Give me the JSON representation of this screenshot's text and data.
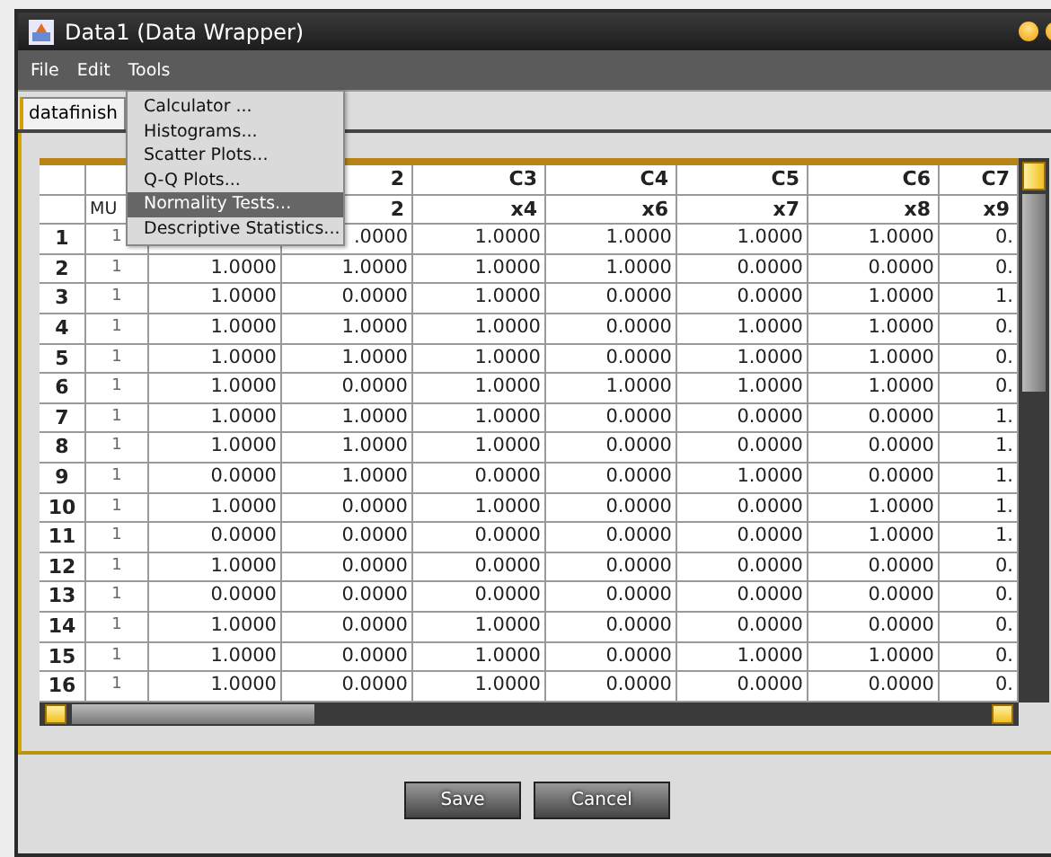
{
  "window": {
    "title": "Data1 (Data Wrapper)"
  },
  "menu_bar": [
    "File",
    "Edit",
    "Tools"
  ],
  "tools_menu": [
    {
      "label": "Calculator ...",
      "selected": false
    },
    {
      "label": "Histograms...",
      "selected": false
    },
    {
      "label": "Scatter Plots...",
      "selected": false
    },
    {
      "label": "Q-Q Plots...",
      "selected": false
    },
    {
      "label": "Normality Tests...",
      "selected": true
    },
    {
      "label": "Descriptive Statistics...",
      "selected": false
    }
  ],
  "tabs": [
    {
      "label": "datafinish",
      "selected": true
    }
  ],
  "table": {
    "columns": [
      {
        "name": "MU"
      },
      {},
      {
        "id": "2",
        "name": "2"
      },
      {
        "id": "C3",
        "name": "x4"
      },
      {
        "id": "C4",
        "name": "x6"
      },
      {
        "id": "C5",
        "name": "x7"
      },
      {
        "id": "C6",
        "name": "x8"
      },
      {
        "id": "C7",
        "name": "x9"
      }
    ],
    "rows": [
      {
        "number": "1",
        "cells": [
          "1",
          {
            "covered": true
          },
          ".0000",
          "1.0000",
          "1.0000",
          "1.0000",
          "1.0000",
          "0."
        ]
      },
      {
        "number": "2",
        "cells": [
          "1",
          "1.0000",
          "1.0000",
          "1.0000",
          "1.0000",
          "0.0000",
          "0.0000",
          "0."
        ]
      },
      {
        "number": "3",
        "cells": [
          "1",
          "1.0000",
          "0.0000",
          "1.0000",
          "0.0000",
          "0.0000",
          "1.0000",
          "1."
        ]
      },
      {
        "number": "4",
        "cells": [
          "1",
          "1.0000",
          "1.0000",
          "1.0000",
          "0.0000",
          "1.0000",
          "1.0000",
          "0."
        ]
      },
      {
        "number": "5",
        "cells": [
          "1",
          "1.0000",
          "1.0000",
          "1.0000",
          "0.0000",
          "1.0000",
          "1.0000",
          "0."
        ]
      },
      {
        "number": "6",
        "cells": [
          "1",
          "1.0000",
          "0.0000",
          "1.0000",
          "1.0000",
          "1.0000",
          "1.0000",
          "0."
        ]
      },
      {
        "number": "7",
        "cells": [
          "1",
          "1.0000",
          "1.0000",
          "1.0000",
          "0.0000",
          "0.0000",
          "0.0000",
          "1."
        ]
      },
      {
        "number": "8",
        "cells": [
          "1",
          "1.0000",
          "1.0000",
          "1.0000",
          "0.0000",
          "0.0000",
          "0.0000",
          "1."
        ]
      },
      {
        "number": "9",
        "cells": [
          "1",
          "0.0000",
          "1.0000",
          "0.0000",
          "0.0000",
          "1.0000",
          "0.0000",
          "1."
        ]
      },
      {
        "number": "10",
        "cells": [
          "1",
          "1.0000",
          "0.0000",
          "1.0000",
          "0.0000",
          "0.0000",
          "1.0000",
          "1."
        ]
      },
      {
        "number": "11",
        "cells": [
          "1",
          "0.0000",
          "0.0000",
          "0.0000",
          "0.0000",
          "0.0000",
          "1.0000",
          "1."
        ]
      },
      {
        "number": "12",
        "cells": [
          "1",
          "1.0000",
          "0.0000",
          "0.0000",
          "0.0000",
          "0.0000",
          "0.0000",
          "0."
        ]
      },
      {
        "number": "13",
        "cells": [
          "1",
          "0.0000",
          "0.0000",
          "0.0000",
          "0.0000",
          "0.0000",
          "0.0000",
          "0."
        ]
      },
      {
        "number": "14",
        "cells": [
          "1",
          "1.0000",
          "0.0000",
          "1.0000",
          "0.0000",
          "0.0000",
          "0.0000",
          "0."
        ]
      },
      {
        "number": "15",
        "cells": [
          "1",
          "1.0000",
          "0.0000",
          "1.0000",
          "0.0000",
          "1.0000",
          "1.0000",
          "0."
        ]
      },
      {
        "number": "16",
        "cells": [
          "1",
          "1.0000",
          "0.0000",
          "1.0000",
          "0.0000",
          "0.0000",
          "0.0000",
          "0."
        ]
      }
    ]
  },
  "buttons": [
    "Save",
    "Cancel"
  ]
}
